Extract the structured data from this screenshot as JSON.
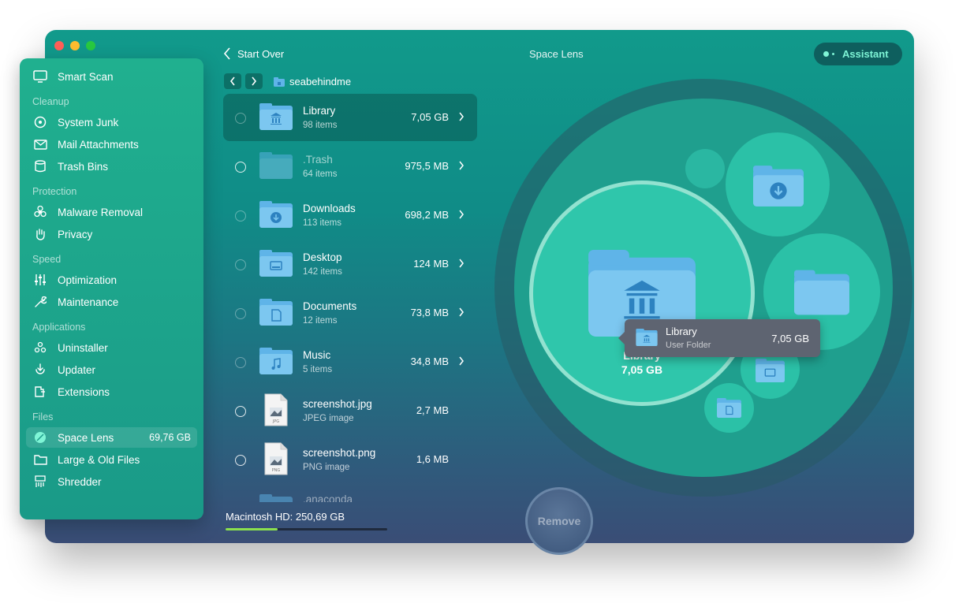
{
  "window": {
    "title": "Space Lens"
  },
  "colors": {
    "accent_green": "#7ff5d6",
    "folder_blue": "#5fb4e8",
    "disk_bar": "#8be04e"
  },
  "sidebar": {
    "smart_scan": "Smart Scan",
    "sections": {
      "cleanup": "Cleanup",
      "protection": "Protection",
      "speed": "Speed",
      "applications": "Applications",
      "files": "Files"
    },
    "items": {
      "system_junk": "System Junk",
      "mail_attachments": "Mail Attachments",
      "trash_bins": "Trash Bins",
      "malware_removal": "Malware Removal",
      "privacy": "Privacy",
      "optimization": "Optimization",
      "maintenance": "Maintenance",
      "uninstaller": "Uninstaller",
      "updater": "Updater",
      "extensions": "Extensions",
      "space_lens": "Space Lens",
      "space_lens_size": "69,76 GB",
      "large_old_files": "Large & Old Files",
      "shredder": "Shredder"
    }
  },
  "header": {
    "start_over": "Start Over",
    "assistant": "Assistant",
    "breadcrumb_folder": "seabehindme"
  },
  "files": [
    {
      "name": "Library",
      "sub": "98 items",
      "size": "7,05 GB",
      "icon": "library-folder"
    },
    {
      "name": ".Trash",
      "sub": "64 items",
      "size": "975,5 MB",
      "icon": "folder"
    },
    {
      "name": "Downloads",
      "sub": "113 items",
      "size": "698,2 MB",
      "icon": "downloads-folder"
    },
    {
      "name": "Desktop",
      "sub": "142 items",
      "size": "124 MB",
      "icon": "desktop-folder"
    },
    {
      "name": "Documents",
      "sub": "12 items",
      "size": "73,8 MB",
      "icon": "documents-folder"
    },
    {
      "name": "Music",
      "sub": "5 items",
      "size": "34,8 MB",
      "icon": "music-folder"
    },
    {
      "name": "screenshot.jpg",
      "sub": "JPEG image",
      "size": "2,7 MB",
      "icon": "jpg-file"
    },
    {
      "name": "screenshot.png",
      "sub": "PNG image",
      "size": "1,6 MB",
      "icon": "png-file"
    },
    {
      "name": ".anaconda",
      "sub": "",
      "size": "",
      "icon": "folder"
    }
  ],
  "disk": {
    "label": "Macintosh HD: 250,69 GB",
    "used_fraction": 0.32
  },
  "lens": {
    "center_name": "Library",
    "center_size": "7,05 GB"
  },
  "tooltip": {
    "name": "Library",
    "sub": "User Folder",
    "size": "7,05 GB"
  },
  "remove_button": "Remove"
}
